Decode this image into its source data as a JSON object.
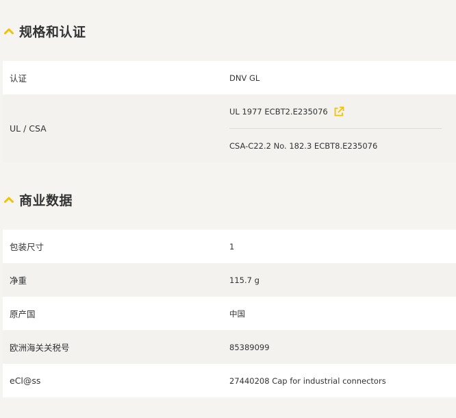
{
  "sections": [
    {
      "title": "规格和认证",
      "rows": [
        {
          "label": "认证",
          "value": "DNV GL"
        },
        {
          "label": "UL / CSA",
          "values": [
            "UL 1977 ECBT2.E235076",
            "CSA-C22.2 No. 182.3 ECBT8.E235076"
          ],
          "link_icon": "external-link-icon"
        }
      ]
    },
    {
      "title": "商业数据",
      "rows": [
        {
          "label": "包装尺寸",
          "value": "1"
        },
        {
          "label": "净重",
          "value": "115.7 g"
        },
        {
          "label": "原产国",
          "value": "中国"
        },
        {
          "label": "欧洲海关关税号",
          "value": "85389099"
        },
        {
          "label": "eCl@ss",
          "value": "27440208 Cap for industrial connectors"
        }
      ]
    }
  ],
  "colors": {
    "accent": "#f2c100",
    "row_white": "#ffffff",
    "row_grey": "#f3f2ef",
    "background": "#f5f4f1"
  },
  "icons": {
    "section_toggle": "chevron-up-icon",
    "link": "external-link-icon"
  }
}
